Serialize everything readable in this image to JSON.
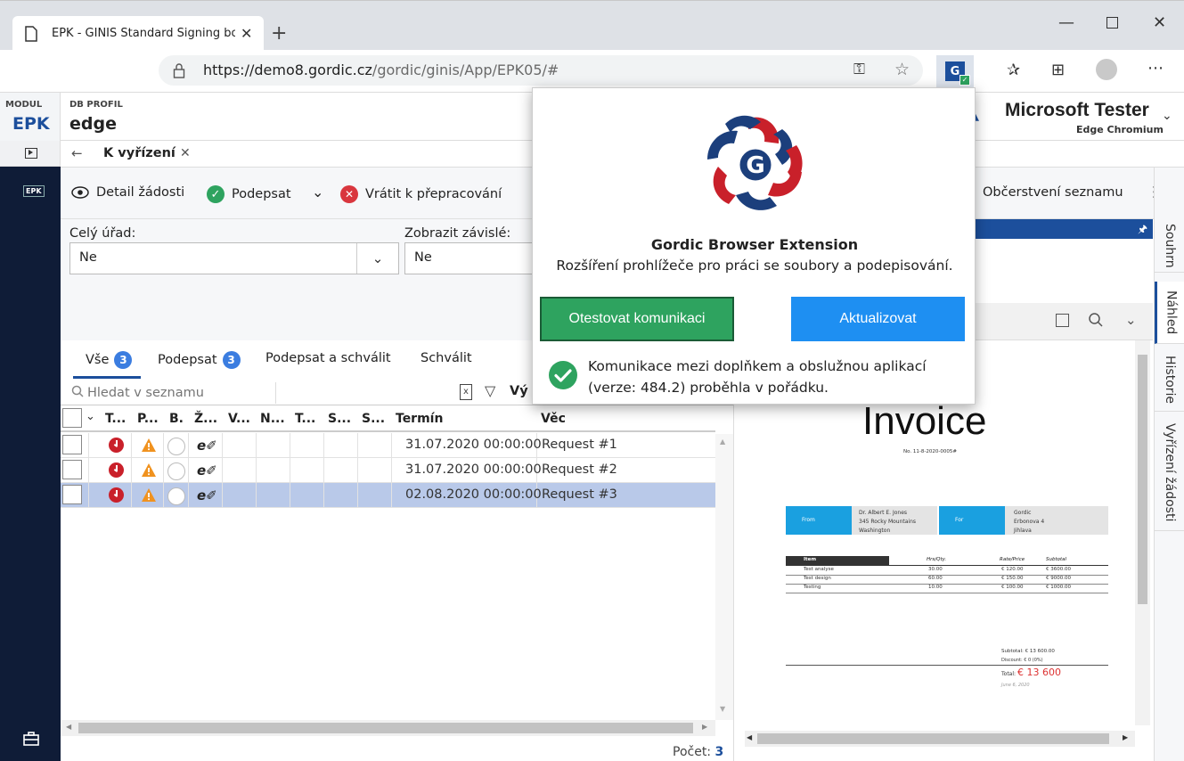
{
  "browser": {
    "tab_title": "EPK - GINIS Standard Signing bo",
    "url_host": "https://demo8.gordic.cz",
    "url_path": "/gordic/ginis/App/EPK05/#"
  },
  "header": {
    "modul_label": "MODUL",
    "modul_value": "EPK",
    "db_label": "DB PROFIL",
    "db_value": "edge",
    "user_name": "Microsoft Tester",
    "user_sub": "Edge Chromium"
  },
  "nav": {
    "epk_item": "EPK"
  },
  "breadcrumb": {
    "title": "K vyřízení"
  },
  "toolbar": {
    "detail": "Detail žádosti",
    "sign": "Podepsat",
    "return": "Vrátit k přepracování",
    "refresh": "Občerstvení seznamu"
  },
  "filters": {
    "office_label": "Celý úřad:",
    "office_value": "Ne",
    "dependent_label": "Zobrazit závislé:",
    "dependent_value": "Ne"
  },
  "list_tabs": [
    {
      "label": "Vše",
      "count": "3"
    },
    {
      "label": "Podepsat",
      "count": "3"
    },
    {
      "label": "Podepsat a schválit"
    },
    {
      "label": "Schválit"
    }
  ],
  "search": {
    "placeholder": "Hledat v seznamu",
    "cut_label": "Vý"
  },
  "table": {
    "headers": [
      "T...",
      "P...",
      "B.",
      "Ž...",
      "V...",
      "N...",
      "T...",
      "S...",
      "S...",
      "Termín",
      "Věc"
    ],
    "rows": [
      {
        "termin": "31.07.2020 00:00:00",
        "vec": "Request #1",
        "selected": false
      },
      {
        "termin": "31.07.2020 00:00:00",
        "vec": "Request #2",
        "selected": false
      },
      {
        "termin": "02.08.2020 00:00:00",
        "vec": "Request #3",
        "selected": true
      }
    ]
  },
  "footer": {
    "count_label": "Počet:",
    "count_value": "3"
  },
  "side_tabs": [
    "Souhrn",
    "Náhled",
    "Historie",
    "Vyřízení žádosti"
  ],
  "invoice": {
    "title": "Invoice",
    "number": "No. 11-8-2020-0005#",
    "from_label": "From",
    "from_lines": [
      "Dr. Albert E. Jones",
      "345 Rocky Mountains",
      "Washington"
    ],
    "for_label": "For",
    "for_lines": [
      "Gordic",
      "Erbonova 4",
      "Jihlava"
    ],
    "cols": [
      "Item",
      "Hrs/Qty.",
      "Rate/Price",
      "Subtotal"
    ],
    "items": [
      [
        "Test analyse",
        "30.00",
        "€ 120.00",
        "€ 3600.00"
      ],
      [
        "Test design",
        "60.00",
        "€ 150.00",
        "€ 9000.00"
      ],
      [
        "Testing",
        "10.00",
        "€ 100.00",
        "€ 1000.00"
      ]
    ],
    "subtotal": "Subtotal: € 13 600.00",
    "discount": "Discount: € 0 (0%)",
    "total_label": "Total:",
    "total_value": "€ 13 600",
    "date": "June 6, 2020"
  },
  "popup": {
    "title": "Gordic Browser Extension",
    "subtitle": "Rozšíření prohlížeče pro práci se soubory a podepisování.",
    "test_button": "Otestovat komunikaci",
    "update_button": "Aktualizovat",
    "status_line1": "Komunikace mezi doplňkem a obslužnou aplikací",
    "status_line2": "(verze: 484.2) proběhla v pořádku."
  },
  "colors": {
    "nav_dark": "#0f1c37",
    "brand_blue": "#1c4f9c",
    "success_green": "#2ea35f",
    "primary_blue": "#1e8ff2",
    "selected_row": "#b9c9e9",
    "badge_blue": "#3b7de0"
  }
}
